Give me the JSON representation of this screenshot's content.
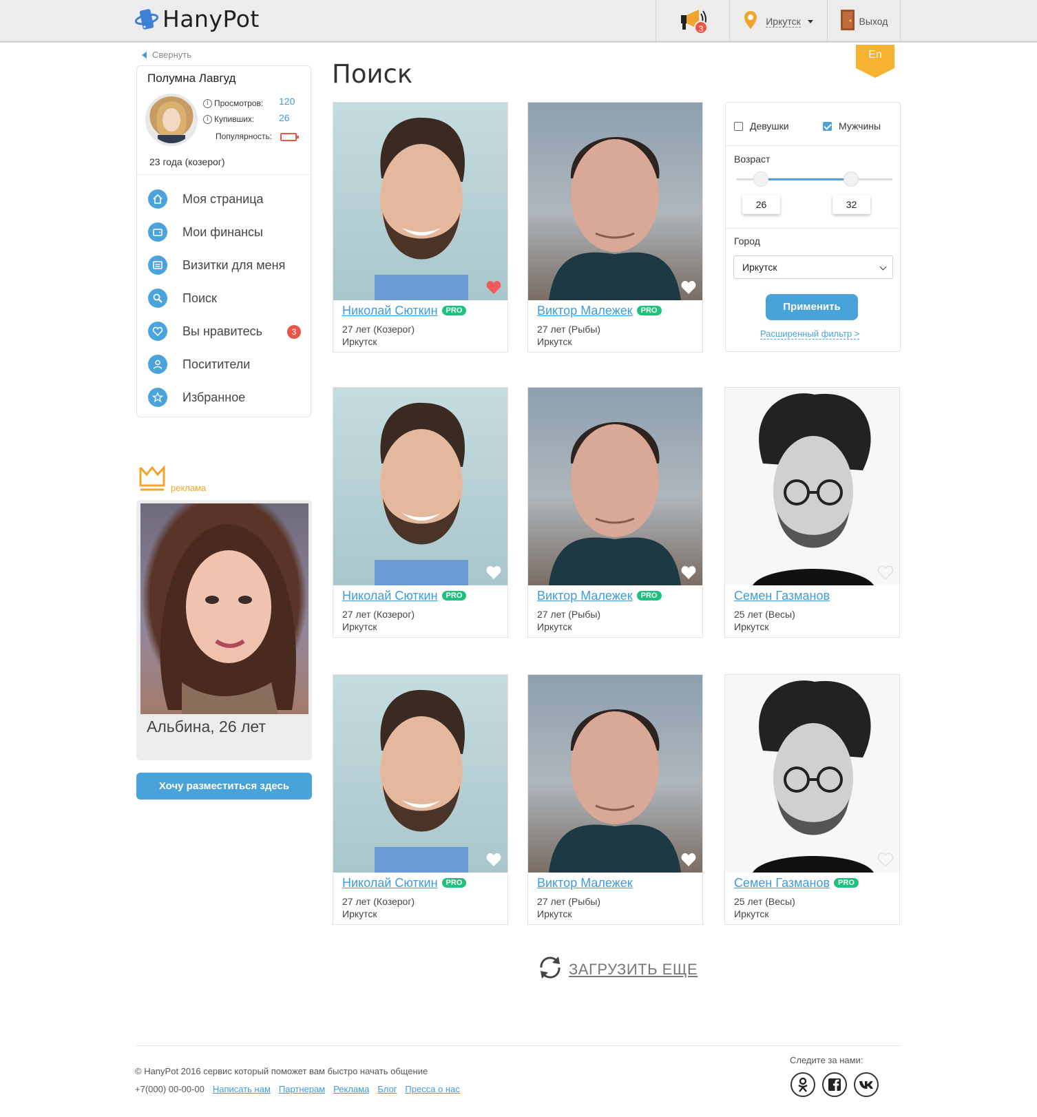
{
  "header": {
    "logo_text": "HanyPot",
    "notifications_count": "3",
    "city": "Иркутск",
    "exit_label": "Выход",
    "lang": "En"
  },
  "sidebar": {
    "collapse_label": "Свернуть",
    "profile": {
      "name": "Полумна Лавгуд",
      "views_label": "Просмотров:",
      "views": "120",
      "buyers_label": "Купивших:",
      "buyers": "26",
      "popularity_label": "Популярность:",
      "age_line": "23 года (козерог)"
    },
    "nav": [
      {
        "label": "Моя страница",
        "icon": "home-icon"
      },
      {
        "label": "Мои финансы",
        "icon": "wallet-icon"
      },
      {
        "label": "Визитки для меня",
        "icon": "card-icon"
      },
      {
        "label": "Поиск",
        "icon": "search-icon"
      },
      {
        "label": "Вы нравитесь",
        "icon": "heart-icon",
        "badge": "3"
      },
      {
        "label": "Поситители",
        "icon": "user-icon"
      },
      {
        "label": "Избранное",
        "icon": "star-icon"
      }
    ],
    "ad": {
      "label": "реклама",
      "caption": "Альбина, 26 лет",
      "button": "Хочу разместиться здесь"
    }
  },
  "main": {
    "title": "Поиск",
    "cards": [
      {
        "name": "Николай Сюткин",
        "pro": "PRO",
        "age": "27 лет (Козерог)",
        "city": "Иркутск",
        "liked": true
      },
      {
        "name": "Виктор Малежек",
        "pro": "PRO",
        "age": "27 лет (Рыбы)",
        "city": "Иркутск",
        "liked": false
      },
      {
        "name": "Николай Сюткин",
        "pro": "PRO",
        "age": "27 лет (Козерог)",
        "city": "Иркутск",
        "liked": false
      },
      {
        "name": "Виктор Малежек",
        "pro": "PRO",
        "age": "27 лет (Рыбы)",
        "city": "Иркутск",
        "liked": false
      },
      {
        "name": "Семен Газманов",
        "pro": "",
        "age": "25 лет (Весы)",
        "city": "Иркутск",
        "liked": false
      },
      {
        "name": "Николай Сюткин",
        "pro": "PRO",
        "age": "27 лет (Козерог)",
        "city": "Иркутск",
        "liked": false
      },
      {
        "name": "Виктор Малежек",
        "pro": "",
        "age": "27 лет (Рыбы)",
        "city": "Иркутск",
        "liked": false
      },
      {
        "name": "Семен Газманов",
        "pro": "PRO",
        "age": "25 лет (Весы)",
        "city": "Иркутск",
        "liked": false
      }
    ],
    "load_more": "ЗАГРУЗИТЬ ЕЩЕ"
  },
  "filter": {
    "girls_label": "Девушки",
    "girls_checked": false,
    "men_label": "Мужчины",
    "men_checked": true,
    "age_label": "Возраст",
    "age_min": "26",
    "age_max": "32",
    "city_label": "Город",
    "city_value": "Иркутск",
    "apply_label": "Применить",
    "advanced_label": "Расширенный фильтр >"
  },
  "footer": {
    "copyright": "© HanyPot 2016 сервис который поможет вам быстро начать общение",
    "phone": "+7(000) 00-00-00",
    "links": [
      "Написать нам",
      "Партнерам",
      "Реклама",
      "Блог",
      "Пресса о нас"
    ],
    "follow_label": "Следите за нами:",
    "social": [
      "odnoklassniki-icon",
      "facebook-icon",
      "vk-icon"
    ]
  },
  "colors": {
    "accent": "#4aa3d8",
    "link": "#3d9be0",
    "badge": "#e8564a",
    "pro": "#1ec27e",
    "ad": "#f0a42b"
  }
}
